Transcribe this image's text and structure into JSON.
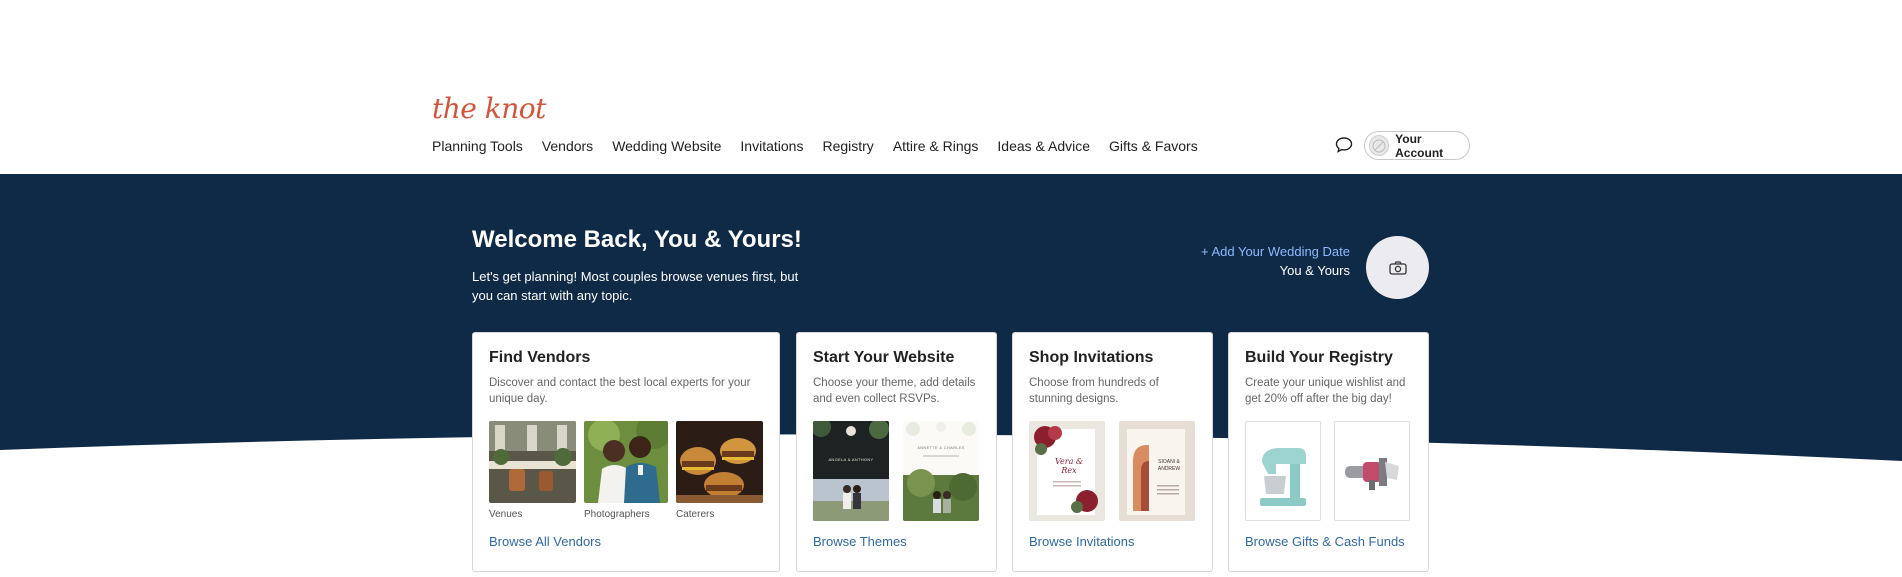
{
  "header": {
    "logo": "the knot",
    "nav": [
      "Planning Tools",
      "Vendors",
      "Wedding Website",
      "Invitations",
      "Registry",
      "Attire & Rings",
      "Ideas & Advice",
      "Gifts & Favors"
    ],
    "account_label": "Your Account"
  },
  "hero": {
    "title": "Welcome Back, You & Yours!",
    "subtitle": "Let's get planning! Most couples browse venues first, but you can start with any topic.",
    "add_date": "+ Add Your Wedding Date",
    "couple_name": "You & Yours"
  },
  "cards": {
    "vendors": {
      "title": "Find Vendors",
      "desc": "Discover and contact the best local experts for your unique day.",
      "captions": [
        "Venues",
        "Photographers",
        "Caterers"
      ],
      "link": "Browse All Vendors"
    },
    "website": {
      "title": "Start Your Website",
      "desc": "Choose your theme, add details and even collect RSVPs.",
      "link": "Browse Themes",
      "theme1_names": "ANGELA & ANTHONY",
      "theme2_names": "ANNETTE & CHARLES"
    },
    "invitations": {
      "title": "Shop Invitations",
      "desc": "Choose from hundreds of stunning designs.",
      "link": "Browse Invitations",
      "inv1_script": "Vera & Rex",
      "inv2_names": "SIOANI & ANDREW"
    },
    "registry": {
      "title": "Build Your Registry",
      "desc": "Create your unique wishlist and get 20% off after the big day!",
      "link": "Browse Gifts & Cash Funds"
    }
  },
  "colors": {
    "navy": "#0f2a47",
    "accent_red": "#d4553a",
    "link_blue": "#2f6aa7",
    "light_blue": "#8fb8ff"
  },
  "icons": [
    "chat-bubble-icon",
    "avatar-icon",
    "camera-icon"
  ]
}
